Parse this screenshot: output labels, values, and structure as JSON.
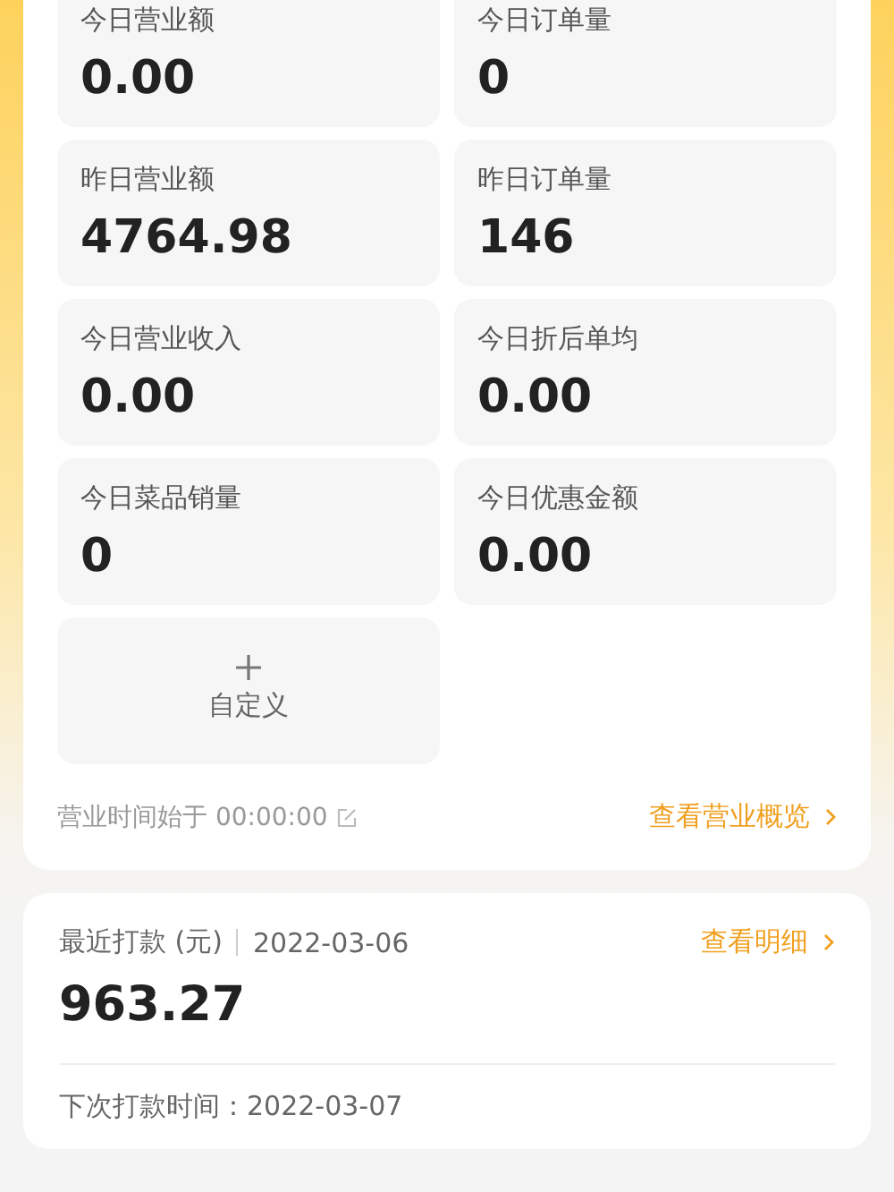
{
  "stats": [
    {
      "label": "今日营业额",
      "value": "0.00"
    },
    {
      "label": "今日订单量",
      "value": "0"
    },
    {
      "label": "昨日营业额",
      "value": "4764.98"
    },
    {
      "label": "昨日订单量",
      "value": "146"
    },
    {
      "label": "今日营业收入",
      "value": "0.00"
    },
    {
      "label": "今日折后单均",
      "value": "0.00"
    },
    {
      "label": "今日菜品销量",
      "value": "0"
    },
    {
      "label": "今日优惠金额",
      "value": "0.00"
    }
  ],
  "custom_tile": {
    "label": "自定义"
  },
  "business_hours": "营业时间始于 00:00:00",
  "overview_link": "查看营业概览",
  "payout": {
    "title": "最近打款 (元)",
    "date": "2022-03-06",
    "detail_link": "查看明细",
    "amount": "963.27",
    "next": "下次打款时间：2022-03-07"
  }
}
